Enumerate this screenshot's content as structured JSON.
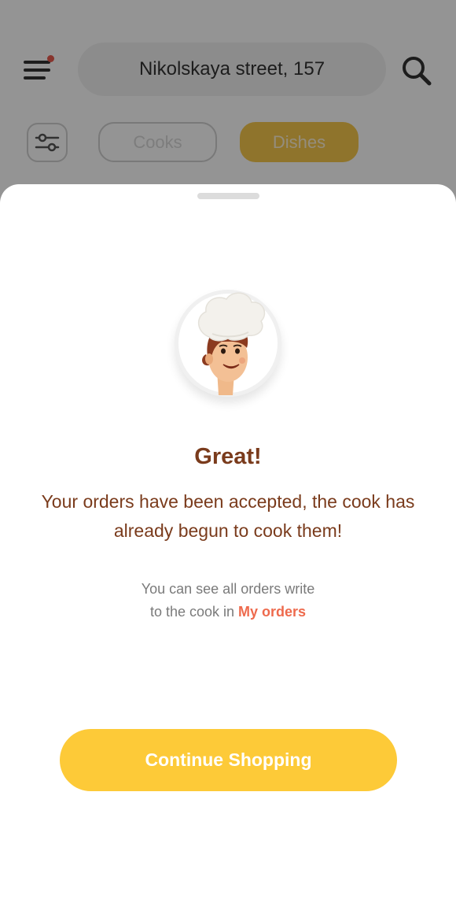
{
  "header": {
    "address": "Nikolskaya street, 157",
    "menu_icon": "hamburger-menu-icon",
    "search_icon": "search-icon",
    "filter_icon": "filter-sliders-icon"
  },
  "tabs": [
    {
      "label": "Cooks",
      "active": false
    },
    {
      "label": "Dishes",
      "active": true
    }
  ],
  "modal": {
    "illustration": "chef-avatar",
    "title": "Great!",
    "message": "Your orders have been accepted, the cook has already begun to cook them!",
    "hint_line1": "You can see all orders write",
    "hint_line2_prefix": "to the cook in",
    "hint_link": "My orders",
    "button_label": "Continue Shopping"
  },
  "colors": {
    "accent_yellow": "#fdca38",
    "title_brown": "#7a3b1c",
    "link_coral": "#ee6a4d",
    "notification_dot": "#e85a4f"
  }
}
